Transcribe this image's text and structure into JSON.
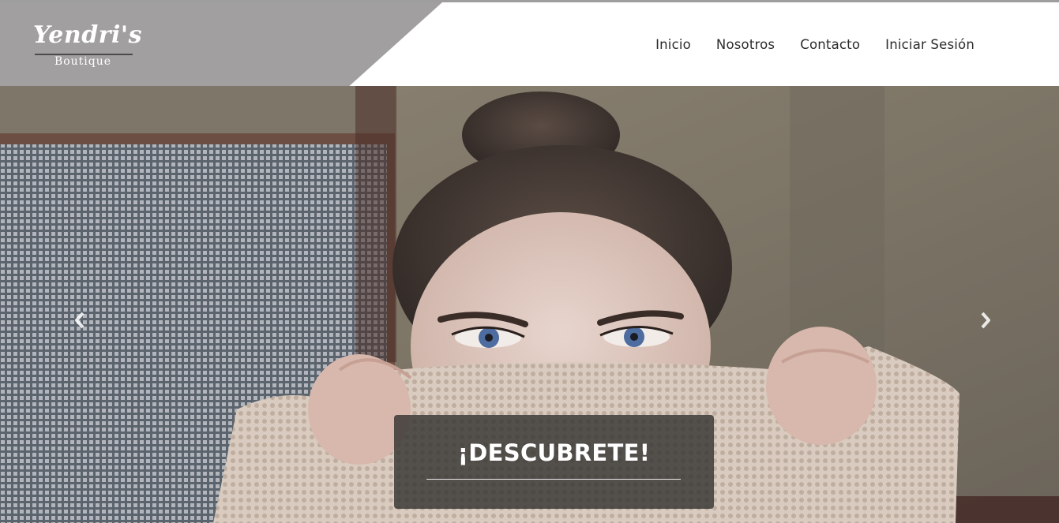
{
  "brand": {
    "name": "Yendri's",
    "subtitle": "Boutique"
  },
  "nav": {
    "items": [
      {
        "label": "Inicio"
      },
      {
        "label": "Nosotros"
      },
      {
        "label": "Contacto"
      },
      {
        "label": "Iniciar Sesión"
      }
    ]
  },
  "hero": {
    "caption_title": "¡DESCUBRETE!",
    "prev_icon": "chevron-left-icon",
    "next_icon": "chevron-right-icon"
  },
  "colors": {
    "brand_panel": "#a19fa0",
    "nav_text": "#2c2c2c",
    "caption_bg": "#2d2d2b",
    "top_line": "#9e9e9e"
  }
}
